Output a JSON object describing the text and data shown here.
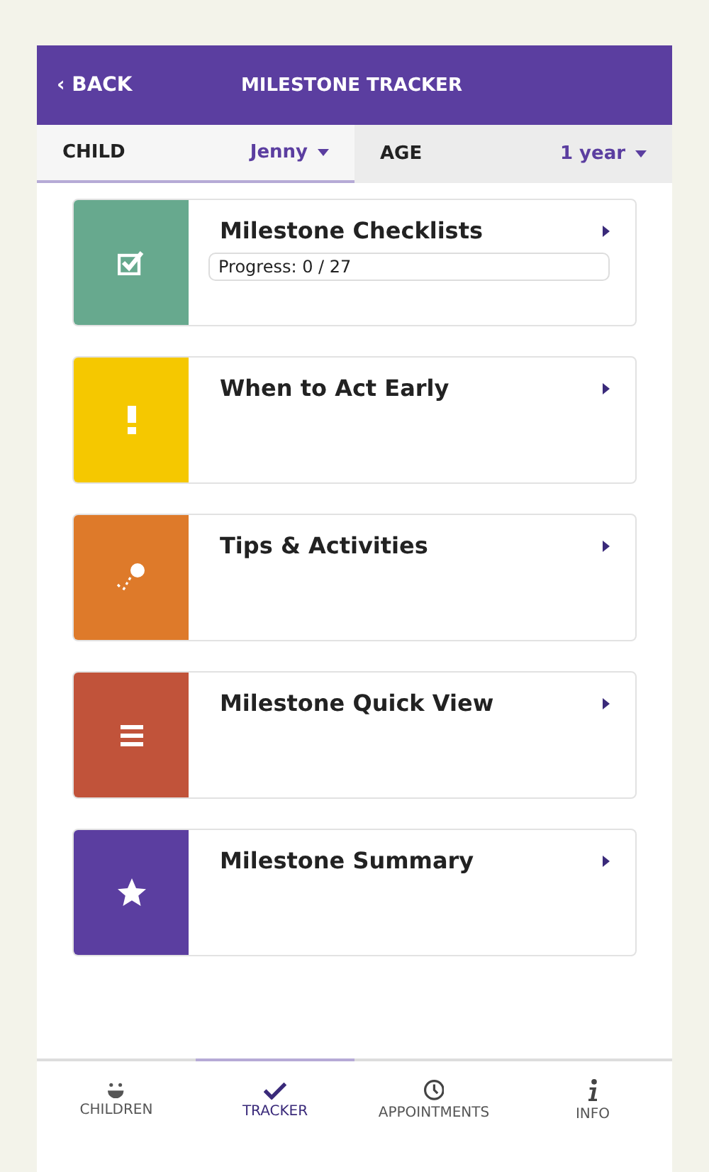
{
  "header": {
    "back": "‹ BACK",
    "title": "MILESTONE TRACKER"
  },
  "selectors": [
    {
      "label": "CHILD",
      "value": "Jenny",
      "selected": true
    },
    {
      "label": "AGE",
      "value": "1 year",
      "selected": false
    }
  ],
  "cards": [
    {
      "title": "Milestone Checklists",
      "kind": "checklist",
      "color": "#67a98e",
      "progress": "Progress: 0 / 27"
    },
    {
      "title": "When to Act Early",
      "kind": "alert",
      "color": "#f5c800"
    },
    {
      "title": "Tips & Activities",
      "kind": "activity",
      "color": "#de7a2a"
    },
    {
      "title": "Milestone Quick View",
      "kind": "list",
      "color": "#c1533a"
    },
    {
      "title": "Milestone Summary",
      "kind": "star",
      "color": "#5b3ea0"
    }
  ],
  "nav": [
    {
      "label": "CHILDREN",
      "kind": "face",
      "selected": false
    },
    {
      "label": "TRACKER",
      "kind": "check",
      "selected": true
    },
    {
      "label": "APPOINTMENTS",
      "kind": "clock",
      "selected": false
    },
    {
      "label": "INFO",
      "kind": "info",
      "selected": false
    }
  ]
}
